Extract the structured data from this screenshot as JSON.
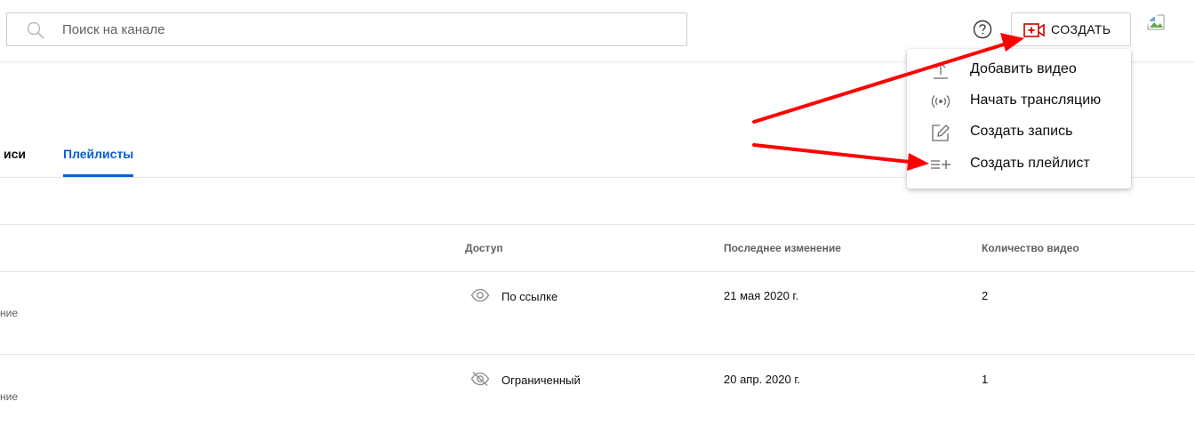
{
  "search": {
    "placeholder": "Поиск на канале"
  },
  "header": {
    "create_label": "СОЗДАТЬ",
    "help_icon": "help-circle-icon",
    "create_icon": "video-camera-plus-icon"
  },
  "menu": {
    "items": [
      {
        "label": "Добавить видео",
        "icon": "upload-icon"
      },
      {
        "label": "Начать трансляцию",
        "icon": "broadcast-icon"
      },
      {
        "label": "Создать запись",
        "icon": "edit-icon"
      },
      {
        "label": "Создать плейлист",
        "icon": "playlist-add-icon"
      }
    ]
  },
  "tabs": [
    {
      "label": "иси",
      "active": false
    },
    {
      "label": "Плейлисты",
      "active": true
    }
  ],
  "table": {
    "headers": {
      "access": "Доступ",
      "last_modified": "Последнее изменение",
      "video_count": "Количество видео"
    },
    "rows": [
      {
        "sub": "ние",
        "access": "По ссылке",
        "access_icon": "eye-icon",
        "date": "21 мая 2020 г.",
        "count": "2"
      },
      {
        "sub": "ние",
        "access": "Ограниченный",
        "access_icon": "eye-off-icon",
        "date": "20 апр. 2020 г.",
        "count": "1"
      }
    ]
  },
  "colors": {
    "accent": "#065fd4",
    "brand_red": "#cc0000",
    "arrow_red": "#ff0000",
    "secondary_text": "#606060"
  }
}
